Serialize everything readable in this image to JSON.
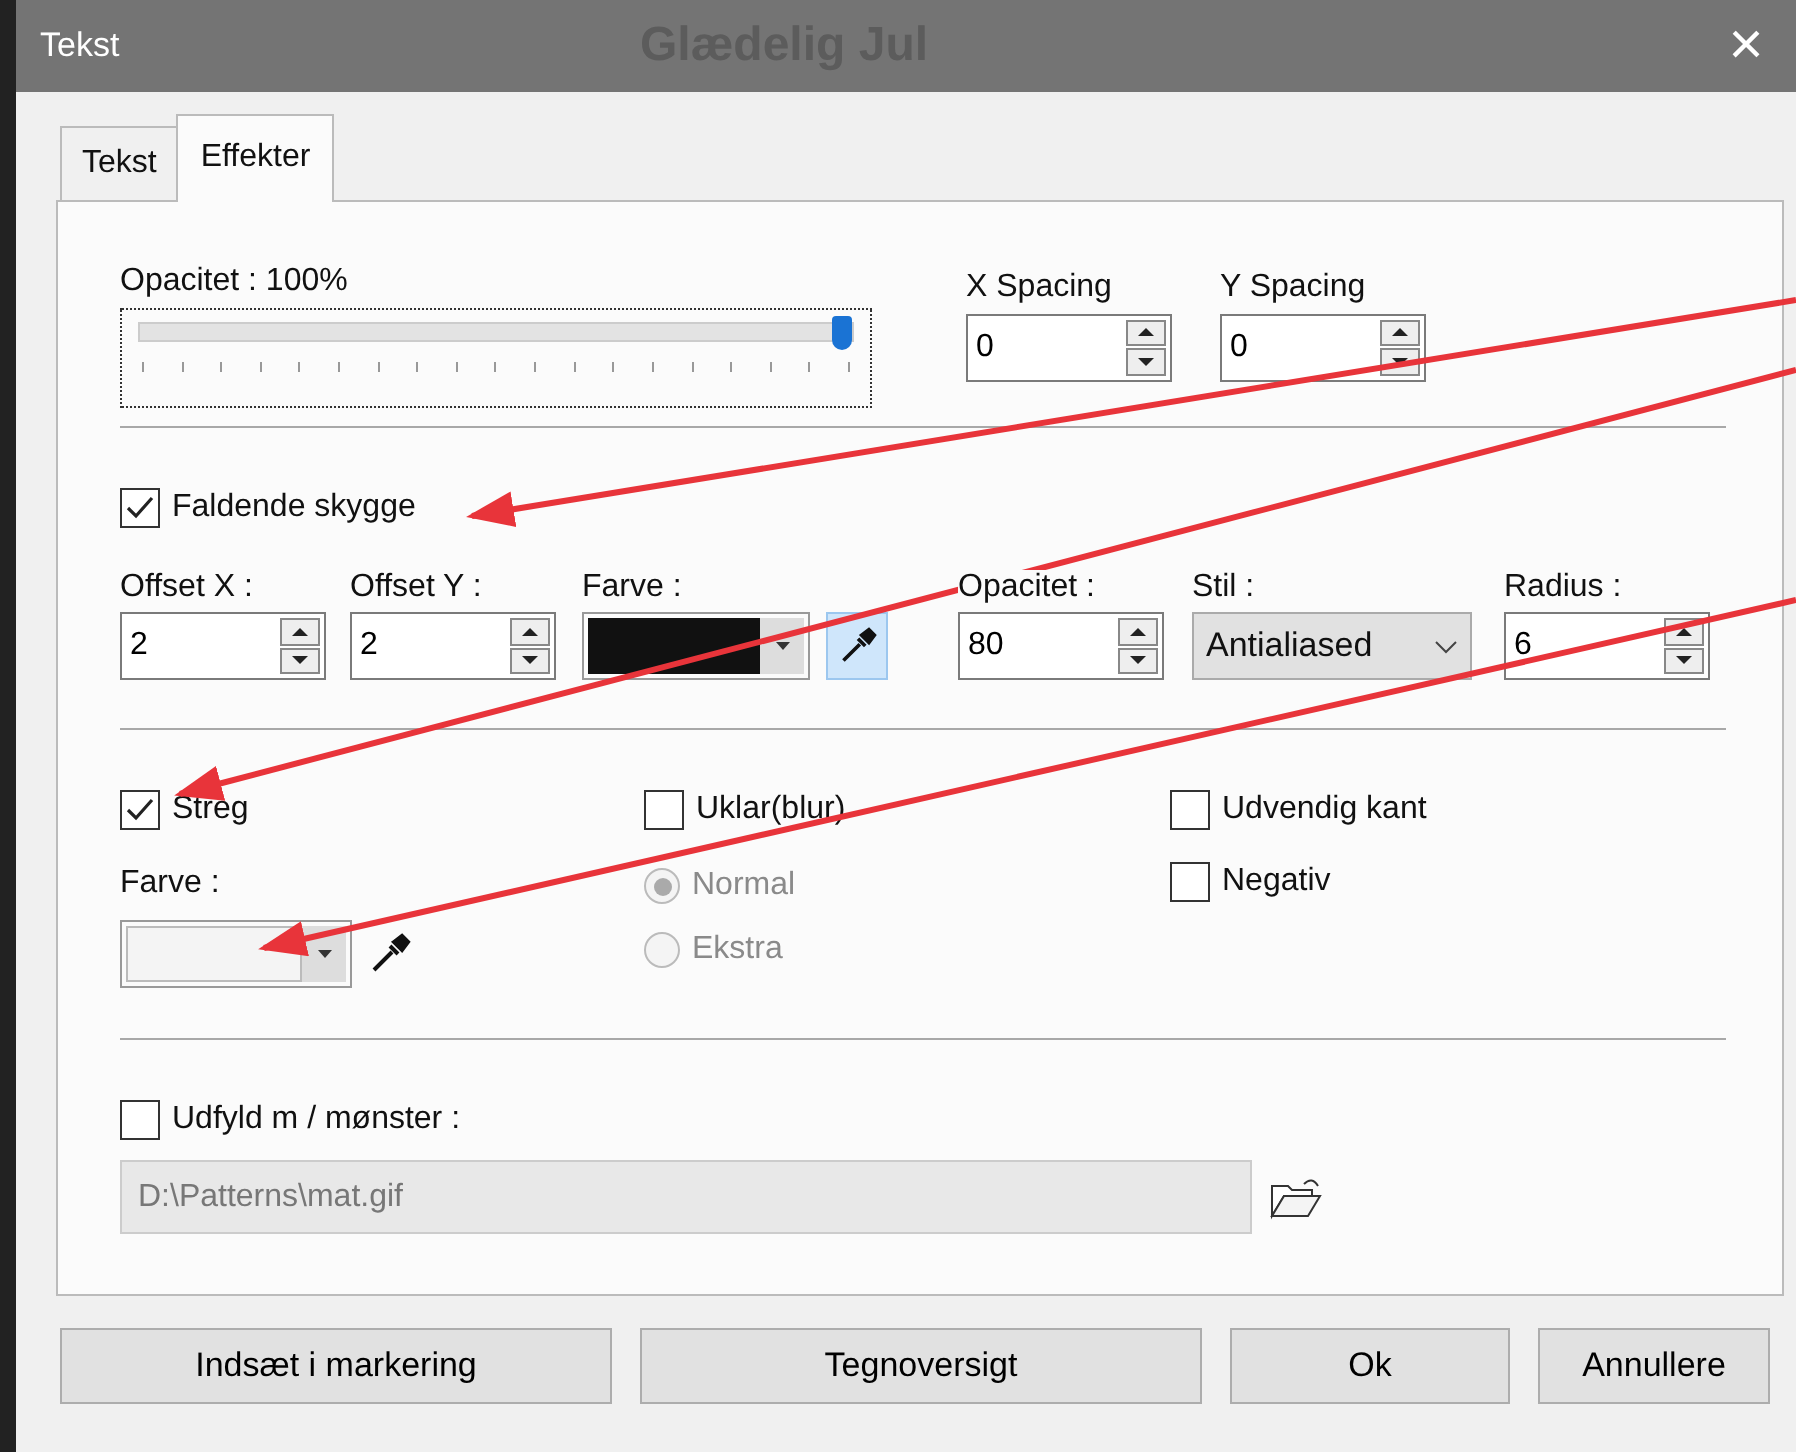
{
  "window": {
    "title": "Tekst",
    "background_text": "Glædelig Jul",
    "close": "×"
  },
  "tabs": [
    {
      "label": "Tekst",
      "selected": false
    },
    {
      "label": "Effekter",
      "selected": true
    }
  ],
  "opacity": {
    "label": "Opacitet : 100%",
    "level": 1
  },
  "spacing": [
    {
      "label": "X Spacing",
      "value": "0"
    },
    {
      "label": "Y Spacing",
      "value": "0"
    }
  ],
  "drop_shadow": {
    "label": "Faldende skygge",
    "checked": true,
    "fields": [
      {
        "kind": "spin",
        "label": "Offset X :",
        "value": "2"
      },
      {
        "kind": "spin",
        "label": "Offset Y :",
        "value": "2"
      },
      {
        "kind": "color",
        "label": "Farve :",
        "color": "#111111"
      },
      {
        "kind": "spin",
        "label": "Opacitet :",
        "value": "80"
      },
      {
        "kind": "select",
        "label": "Stil :",
        "value": "Antialiased"
      },
      {
        "kind": "spin",
        "label": "Radius :",
        "value": "6"
      }
    ]
  },
  "stroke": {
    "label": "Streg",
    "checked": true,
    "color_label": "Farve :",
    "color": "#f4f4f4"
  },
  "blur": {
    "label": "Uklar(blur)",
    "checked": false,
    "options": [
      {
        "label": "Normal",
        "selected": true,
        "disabled": true
      },
      {
        "label": "Ekstra",
        "selected": false,
        "disabled": true
      }
    ]
  },
  "outer_edge": {
    "label": "Udvendig kant",
    "checked": false
  },
  "negative": {
    "label": "Negativ",
    "checked": false
  },
  "pattern": {
    "label": "Udfyld m / mønster :",
    "checked": false,
    "path": "D:\\Patterns\\mat.gif",
    "disabled": true
  },
  "buttons": [
    "Indsæt i markering",
    "Tegnoversigt",
    "Ok",
    "Annullere"
  ]
}
